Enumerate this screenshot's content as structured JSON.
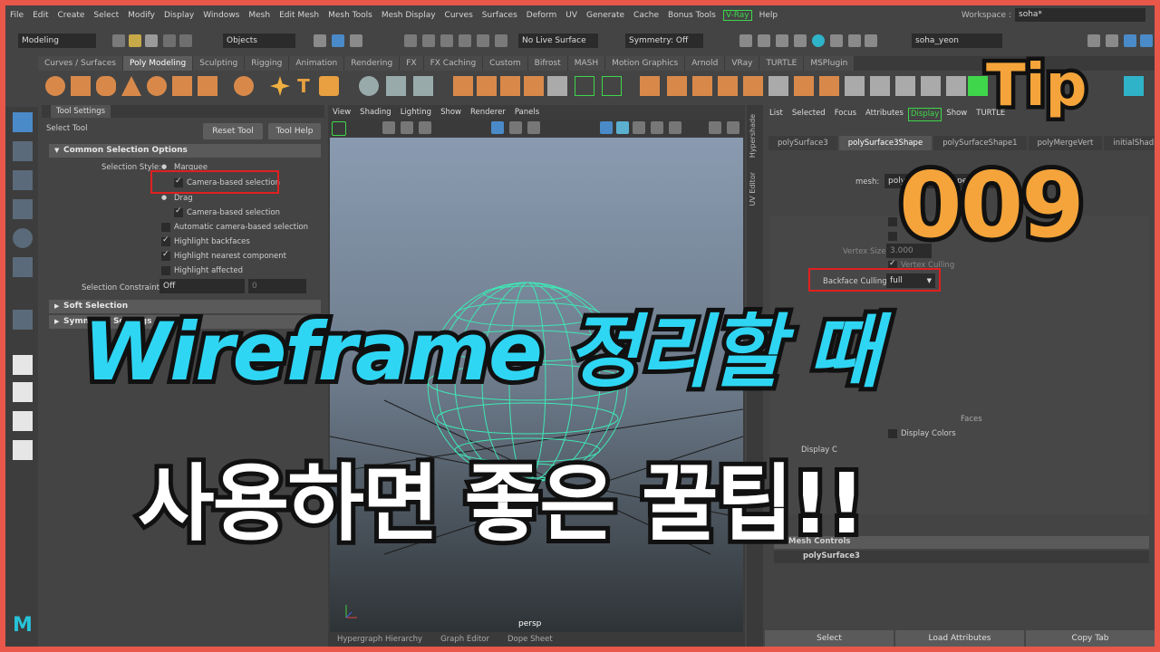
{
  "menubar": {
    "items": [
      "File",
      "Edit",
      "Create",
      "Select",
      "Modify",
      "Display",
      "Windows",
      "Mesh",
      "Edit Mesh",
      "Mesh Tools",
      "Mesh Display",
      "Curves",
      "Surfaces",
      "Deform",
      "UV",
      "Generate",
      "Cache",
      "Bonus Tools",
      "V-Ray",
      "Help"
    ],
    "workspace_label": "Workspace :",
    "workspace_value": "soha*"
  },
  "statusline": {
    "mode": "Modeling",
    "selection_mask": "Objects",
    "live_surface": "No Live Surface",
    "symmetry": "Symmetry: Off",
    "user": "soha_yeon"
  },
  "shelf": {
    "tabs": [
      "Curves / Surfaces",
      "Poly Modeling",
      "Sculpting",
      "Rigging",
      "Animation",
      "Rendering",
      "FX",
      "FX Caching",
      "Custom",
      "Bifrost",
      "MASH",
      "Motion Graphics",
      "Arnold",
      "VRay",
      "TURTLE",
      "MSPlugin"
    ],
    "active_tab": "Poly Modeling"
  },
  "tool_settings": {
    "tab": "Tool Settings",
    "tool_name": "Select Tool",
    "reset_button": "Reset Tool",
    "help_button": "Tool Help",
    "section_common": "Common Selection Options",
    "selection_style_label": "Selection Style:",
    "marquee_label": "Marquee",
    "camera_based_1": "Camera-based selection",
    "drag_label": "Drag",
    "camera_based_2": "Camera-based selection",
    "auto_camera": "Automatic camera-based selection",
    "highlight_backfaces": "Highlight backfaces",
    "highlight_nearest": "Highlight nearest component",
    "highlight_affected": "Highlight affected",
    "constraint_label": "Selection Constraint:",
    "constraint_value": "Off",
    "constraint_number": "0",
    "section_2": "Soft Selection",
    "section_3": "Symmetry Settings"
  },
  "viewport": {
    "menus": [
      "View",
      "Shading",
      "Lighting",
      "Show",
      "Renderer",
      "Panels"
    ],
    "camera_label": "persp",
    "bottom_tabs": [
      "Hypergraph Hierarchy",
      "Graph Editor",
      "Dope Sheet"
    ]
  },
  "side_tabs": [
    "Hypershade",
    "UV Editor"
  ],
  "attribute_editor": {
    "menus": [
      "List",
      "Selected",
      "Focus",
      "Attributes",
      "Display",
      "Show",
      "TURTLE"
    ],
    "node_tabs": [
      "polySurface3",
      "polySurface3Shape",
      "polySurfaceShape1",
      "polyMergeVert",
      "initialShadingG"
    ],
    "active_tab": "polySurface3Shape",
    "mesh_label": "mesh:",
    "mesh_value": "polySurface3Shape",
    "vertex_size_label": "Vertex Size",
    "vertex_size_value": "3.000",
    "vertex_culling": "Vertex Culling",
    "backface_label": "Backface Culling",
    "backface_value": "full",
    "faces_text": "Faces",
    "display_colors": "Display Colors",
    "display_c_label": "Display C",
    "mesh_controls": "Mesh Controls",
    "poly_surface_footer": "polySurface3",
    "buttons": [
      "Select",
      "Load Attributes",
      "Copy Tab"
    ]
  },
  "overlay": {
    "tip_label": "Tip",
    "tip_number": "009",
    "headline_1": "Wireframe 정리할 때",
    "headline_2": "사용하면 좋은 꿀팁!!"
  },
  "colors": {
    "frame": "#e8574a",
    "cyan_headline": "#2fd6f3",
    "tip_orange": "#f4a43a",
    "highlight_red": "#e02020",
    "wireframe": "#3ee8b6",
    "vray_green": "#3fd64b"
  }
}
